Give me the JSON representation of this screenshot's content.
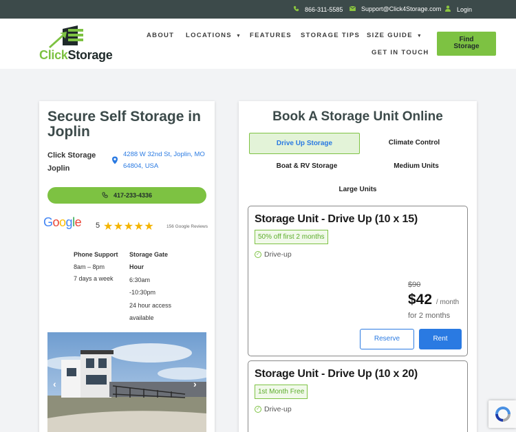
{
  "topbar": {
    "phone": "866-311-5585",
    "email": "Support@Click4Storage.com",
    "login": "Login"
  },
  "brand": {
    "part1": "Click",
    "part2": "Storage",
    "accent_color": "#7dc242",
    "dark_color": "#3c4a4a"
  },
  "nav": {
    "items": [
      "ABOUT",
      "LOCATIONS",
      "FEATURES",
      "STORAGE TIPS",
      "SIZE GUIDE",
      "GET IN TOUCH"
    ],
    "cta_line1": "Find",
    "cta_line2": "Storage"
  },
  "location": {
    "title": "Secure Self Storage in Joplin",
    "name": "Click Storage Joplin",
    "address": "4288 W 32nd St, Joplin, MO 64804, USA",
    "phone": "417-233-4336",
    "rating": "5",
    "stars": "★★★★★",
    "reviews": "156 Google Reviews",
    "phone_support_label": "Phone Support",
    "phone_support_hours": "8am – 8pm",
    "phone_support_days": "7 days a week",
    "gate_label": "Storage Gate Hour",
    "gate_hours": "6:30am -10:30pm",
    "gate_access": "24 hour access available"
  },
  "booking": {
    "title": "Book A Storage Unit Online",
    "tabs": [
      "Drive Up Storage",
      "Climate Control",
      "Boat & RV Storage",
      "Medium Units",
      "Large Units"
    ],
    "active_tab": "Drive Up Storage",
    "units": [
      {
        "title": "Storage Unit - Drive Up (10 x 15)",
        "promo": "50% off first 2 months",
        "feature": "Drive-up",
        "old_price": "$90",
        "price": "$42",
        "per": "/ month",
        "duration": "for 2 months",
        "reserve": "Reserve",
        "rent": "Rent"
      },
      {
        "title": "Storage Unit - Drive Up (10 x 20)",
        "promo": "1st Month Free",
        "feature": "Drive-up"
      }
    ]
  }
}
